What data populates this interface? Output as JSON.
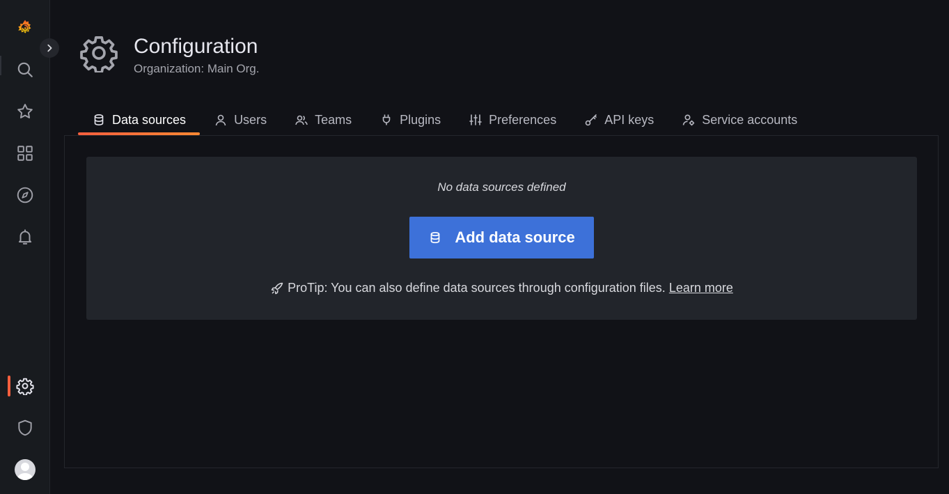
{
  "header": {
    "title": "Configuration",
    "subtitle": "Organization: Main Org."
  },
  "sidebar": {
    "items": [
      {
        "name": "grafana-logo",
        "icon": "grafana-logo-icon"
      },
      {
        "name": "search",
        "icon": "search-icon"
      },
      {
        "name": "starred",
        "icon": "star-icon"
      },
      {
        "name": "dashboards",
        "icon": "apps-grid-icon"
      },
      {
        "name": "explore",
        "icon": "compass-icon"
      },
      {
        "name": "alerting",
        "icon": "bell-icon"
      },
      {
        "name": "configuration",
        "icon": "gear-icon",
        "active": true
      },
      {
        "name": "server-admin",
        "icon": "shield-icon"
      },
      {
        "name": "profile",
        "icon": "avatar"
      }
    ]
  },
  "tabs": [
    {
      "label": "Data sources",
      "icon": "database-icon",
      "active": true
    },
    {
      "label": "Users",
      "icon": "user-icon"
    },
    {
      "label": "Teams",
      "icon": "users-icon"
    },
    {
      "label": "Plugins",
      "icon": "plug-icon"
    },
    {
      "label": "Preferences",
      "icon": "sliders-icon"
    },
    {
      "label": "API keys",
      "icon": "key-icon"
    },
    {
      "label": "Service accounts",
      "icon": "user-cog-icon"
    }
  ],
  "empty_state": {
    "message": "No data sources defined",
    "button_label": "Add data source",
    "protip": "ProTip: You can also define data sources through configuration files.",
    "learn_more": "Learn more"
  },
  "colors": {
    "accent": "#f55f3e",
    "primary_button": "#3d71d9",
    "background": "#111217",
    "sidebar": "#181b1f",
    "panel": "#22252b"
  }
}
